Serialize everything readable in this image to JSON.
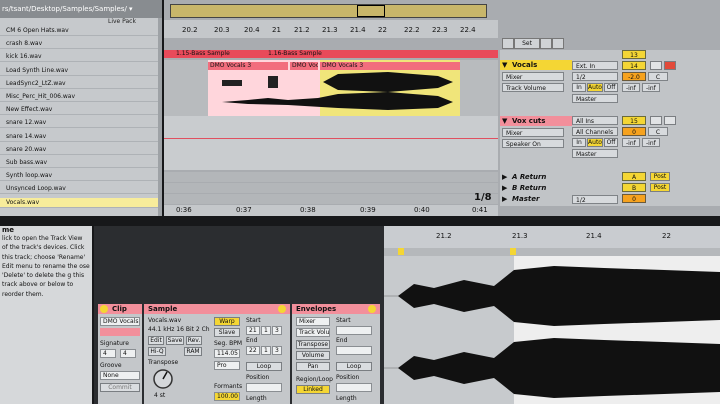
{
  "browser": {
    "path": "rs/tsant/Desktop/Samples/Samples/ ▾",
    "live_pack": "Live Pack",
    "files": [
      "CM 6 Open Hats.wav",
      "crash 8.wav",
      "kick 16.wav",
      "Load Synth Line.wav",
      "LeadSync2_LtZ.wav",
      "Misc_Perc_Hit_006.wav",
      "New Effect.wav",
      "snare 12.wav",
      "snare 14.wav",
      "snare 20.wav",
      "Sub bass.wav",
      "Synth loop.wav",
      "Unsynced Loop.wav",
      "Vocals.wav"
    ],
    "selected_index": 13
  },
  "arrangement": {
    "ruler_labels": [
      "20.2",
      "20.3",
      "20.4",
      "21",
      "21.2",
      "21.3",
      "21.4",
      "22",
      "22.2",
      "22.3",
      "22.4"
    ],
    "set_label": "Set",
    "bottom_times": [
      "0:36",
      "0:37",
      "0:38",
      "0:39",
      "0:40",
      "0:41"
    ],
    "zoom": "1/8",
    "clip_bass": [
      "1.15-Bass Sample",
      "1.16-Bass Sample"
    ],
    "clip_vocals": [
      "DMO Vocals 3",
      "DMO Vocals 3",
      "DMO Vocals 3"
    ],
    "tracks": {
      "vocals": {
        "name": "Vocals",
        "input_type": "Ext. In",
        "input_channel": "1/2",
        "monitor": [
          "In",
          "Auto",
          "Off"
        ],
        "output": "Master",
        "number": "14",
        "volume": "-2.0",
        "pan": "C",
        "mixer": "Mixer",
        "envelope": "Track Volume",
        "meter_l": "-inf",
        "meter_r": "-inf"
      },
      "vox_cuts": {
        "name": "Vox cuts",
        "input_type": "All Ins",
        "input_channel": "All Channels",
        "monitor": [
          "In",
          "Auto",
          "Off"
        ],
        "output": "Master",
        "number": "15",
        "volume": "0",
        "pan": "C",
        "mixer": "Mixer",
        "envelope": "Speaker On",
        "meter_l": "-inf",
        "meter_r": "-inf"
      },
      "a_return": {
        "name": "A Return",
        "letter": "A",
        "post": "Post"
      },
      "b_return": {
        "name": "B Return",
        "letter": "B",
        "post": "Post"
      },
      "master": {
        "name": "Master",
        "channel": "1/2",
        "meter": "0"
      },
      "top_numbers": [
        "13",
        "-6"
      ]
    }
  },
  "info": {
    "title": "me",
    "text": "lick to open the Track View of the track's devices. Click this track; choose 'Rename' Edit menu to rename the ose 'Delete' to delete the g this track above or below to reorder them."
  },
  "clip": {
    "title": "Clip",
    "name": "DMO Vocals",
    "sig_label": "Signature",
    "sig_num": "4",
    "sig_den": "4",
    "groove_label": "Groove",
    "groove_value": "None",
    "commit": "Commit"
  },
  "sample": {
    "title": "Sample",
    "file": "Vocals.wav",
    "format": "44.1 kHz 16 Bit 2 Ch",
    "buttons": [
      "Edit",
      "Save",
      "Rev."
    ],
    "hiq": "Hi-Q",
    "ram": "RAM",
    "transpose_label": "Transpose",
    "transpose_value": "4 st",
    "warp": "Warp",
    "slave": "Slave",
    "seg_bpm_label": "Seg. BPM",
    "seg_bpm": "114.05",
    "mode": "Pro",
    "formants_label": "Formants",
    "formants": "100.00",
    "start_label": "Start",
    "start_vals": [
      "21",
      "1",
      "3"
    ],
    "end_label": "End",
    "end_vals": [
      "22",
      "1",
      "3"
    ],
    "loop_label": "Loop",
    "position_label": "Position",
    "length_label": "Length"
  },
  "envelopes": {
    "title": "Envelopes",
    "device": "Mixer",
    "param": "Track Volume",
    "buttons": [
      "Transpose",
      "Volume",
      "Pan"
    ],
    "region_label": "Region/Loop",
    "linked": "Linked",
    "start_label": "Start",
    "end_label": "End",
    "loop_label": "Loop",
    "position_label": "Position",
    "length_label": "Length"
  },
  "editor": {
    "ruler_labels": [
      "21.2",
      "21.3",
      "21.4",
      "22"
    ]
  }
}
